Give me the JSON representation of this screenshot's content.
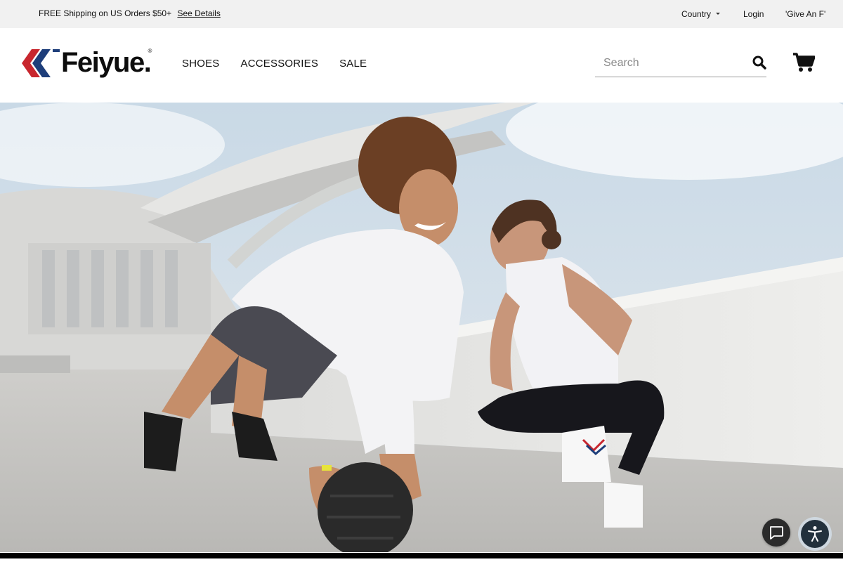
{
  "topbar": {
    "promo_text": "FREE Shipping on US Orders $50+",
    "promo_link": "See Details",
    "country_label": "Country",
    "login_label": "Login",
    "give_label": "'Give An F'"
  },
  "header": {
    "logo_text": "Feiyue.",
    "logo_reg": "®",
    "nav": [
      "SHOES",
      "ACCESSORIES",
      "SALE"
    ],
    "search_placeholder": "Search"
  },
  "icons": {
    "search": "search-icon",
    "cart": "cart-icon",
    "chat": "chat-icon",
    "accessibility": "accessibility-icon",
    "country_caret": "chevron-down-icon"
  },
  "colors": {
    "topbar_bg": "#f1f1f1",
    "logo_red": "#c8262e",
    "logo_blue": "#1e3e7a",
    "text": "#111111"
  }
}
